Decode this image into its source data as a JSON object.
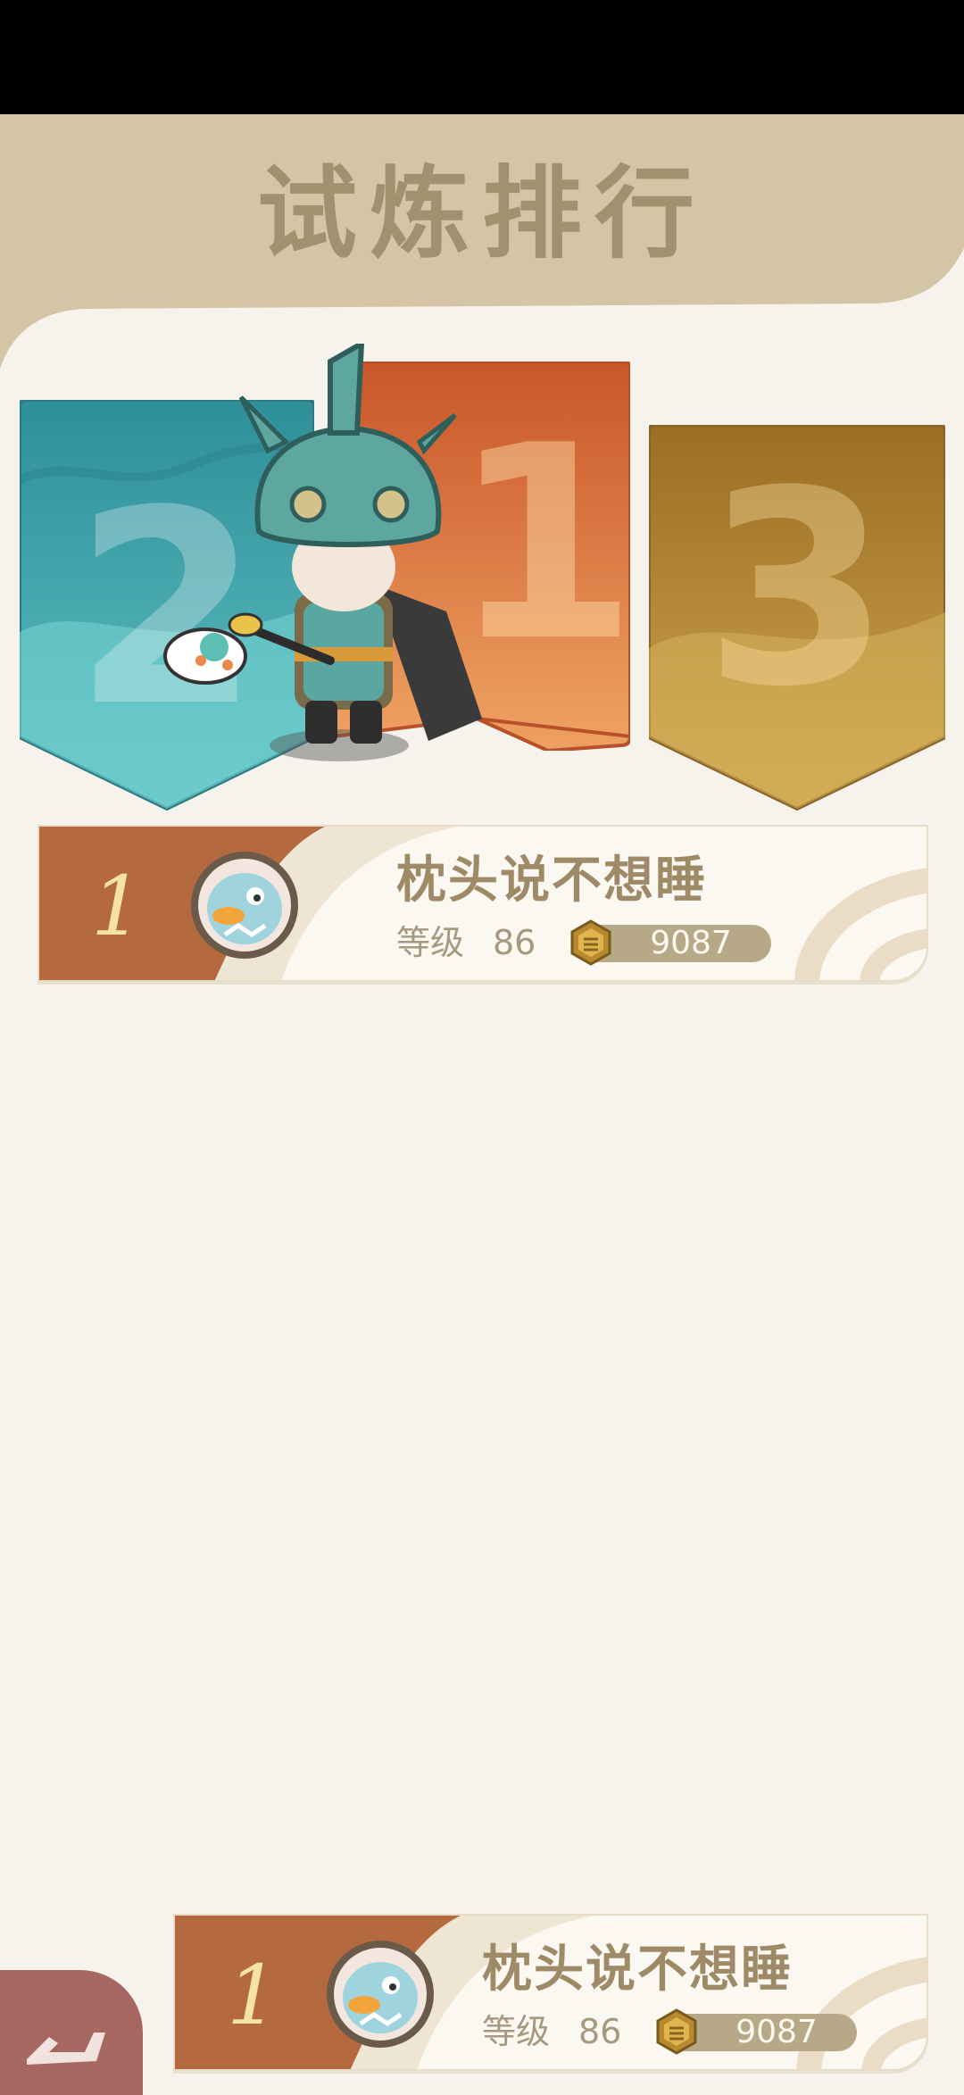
{
  "title": "试炼排行",
  "podium": [
    {
      "rank": "2",
      "color": "#4aa5ad"
    },
    {
      "rank": "1",
      "color": "#d86a33"
    },
    {
      "rank": "3",
      "color": "#b08434"
    }
  ],
  "rank_row": {
    "rank": "1",
    "name": "枕头说不想睡",
    "level_label": "等级",
    "level": "86",
    "score": "9087"
  },
  "my_rank": {
    "rank": "1",
    "name": "枕头说不想睡",
    "level_label": "等级",
    "level": "86",
    "score": "9087"
  },
  "icons": {
    "coin": "coin-icon",
    "avatar": "penguin-avatar",
    "back": "back-arrow-icon"
  }
}
